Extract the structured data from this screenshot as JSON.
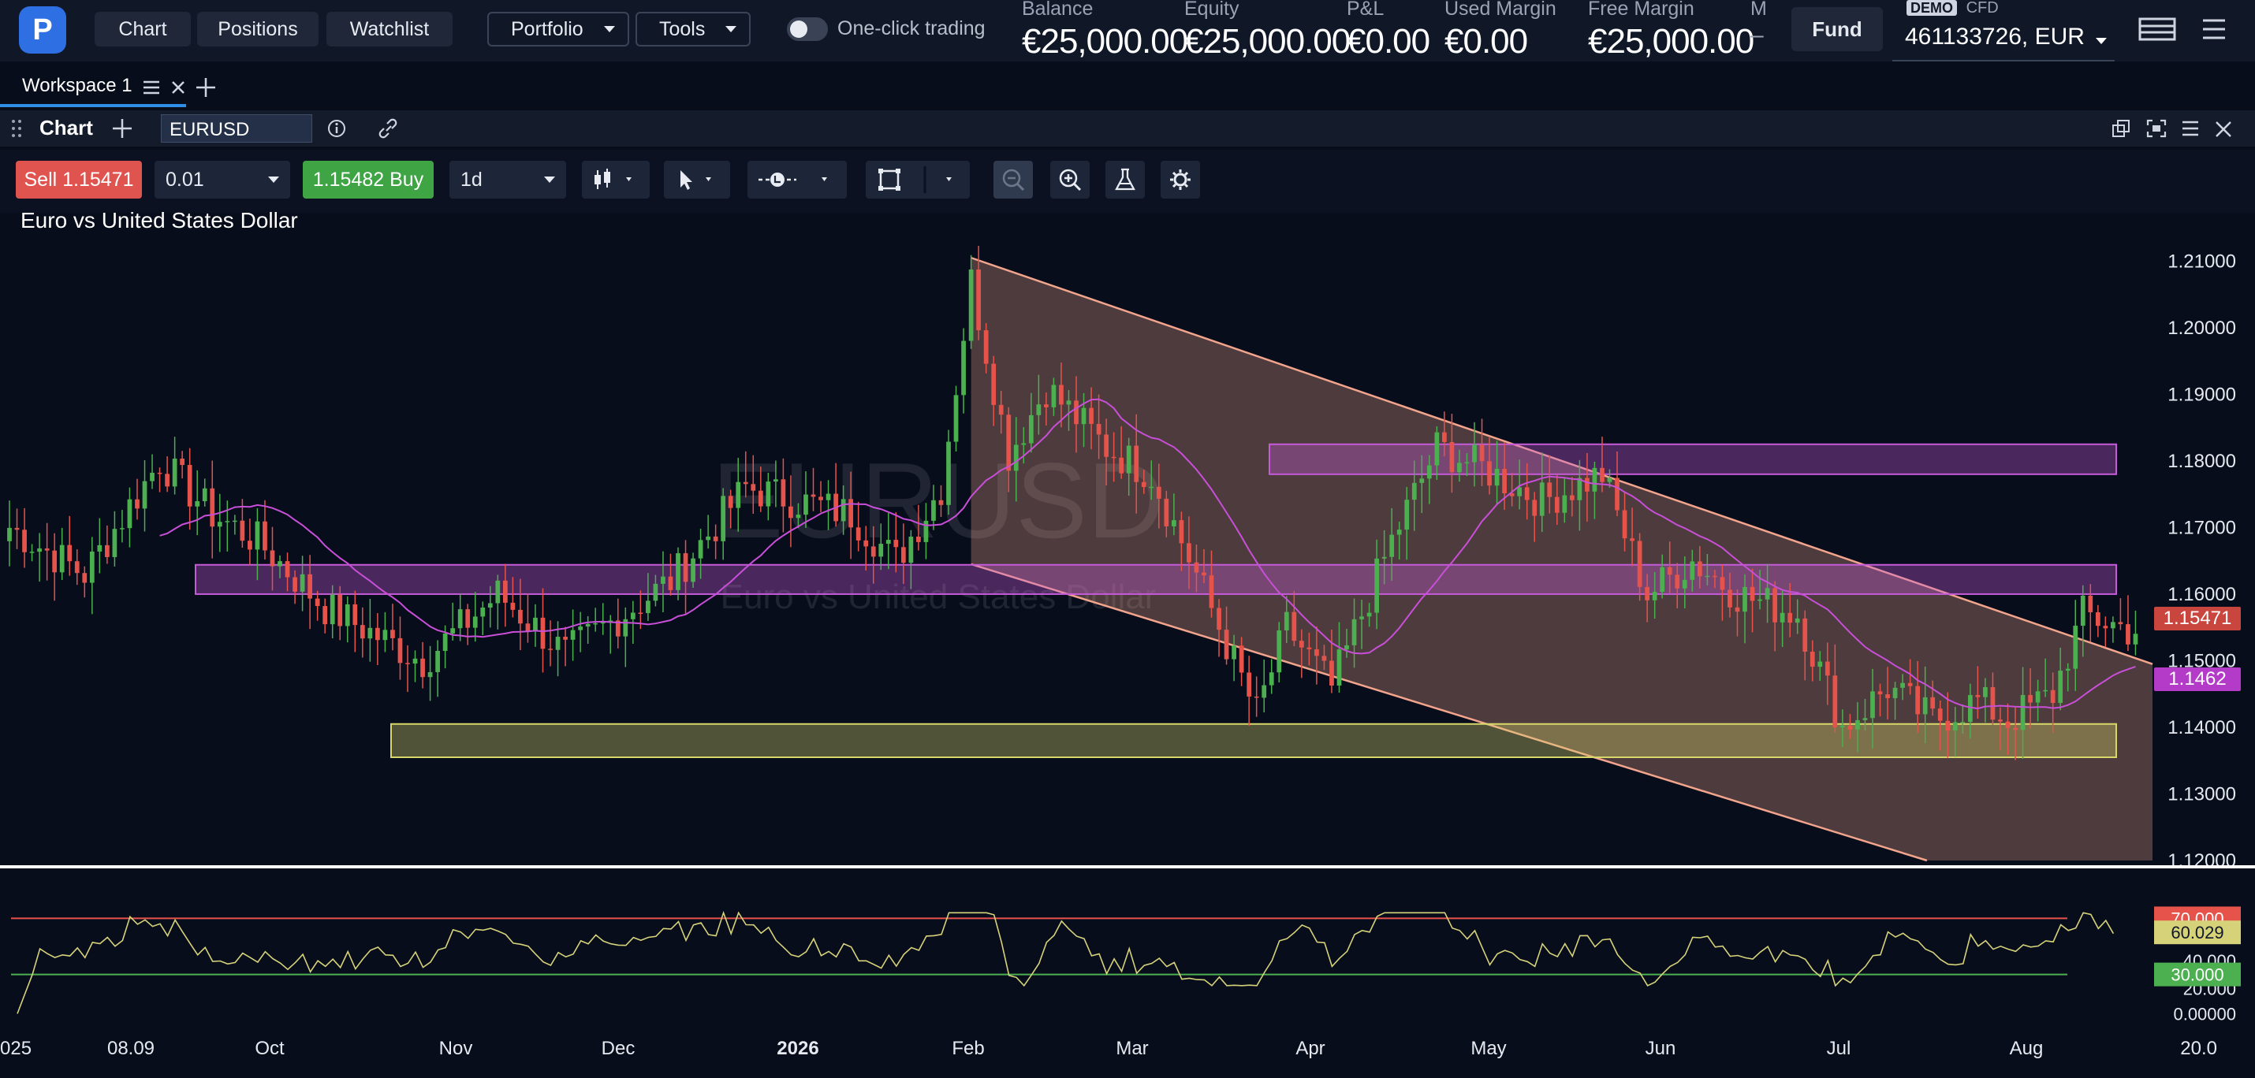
{
  "header": {
    "logo_letter": "P",
    "nav": [
      "Chart",
      "Positions",
      "Watchlist"
    ],
    "portfolio_label": "Portfolio",
    "tools_label": "Tools",
    "one_click_label": "One-click trading",
    "stats": [
      {
        "label": "Balance",
        "value": "€25,000.00"
      },
      {
        "label": "Equity",
        "value": "€25,000.00"
      },
      {
        "label": "P&L",
        "value": "€0.00"
      },
      {
        "label": "Used Margin",
        "value": "€0.00"
      },
      {
        "label": "Free Margin",
        "value": "€25,000.00"
      },
      {
        "label": "M",
        "value": "–"
      }
    ],
    "fund_label": "Fund",
    "demo_badge": "DEMO",
    "cfd_label": "CFD",
    "account": "461133726, EUR"
  },
  "workspace": {
    "tab_label": "Workspace 1"
  },
  "chart_panel": {
    "title": "Chart",
    "symbol": "EURUSD",
    "sell_label": "Sell",
    "sell_price": "1.15471",
    "quantity": "0.01",
    "buy_price": "1.15482",
    "buy_label": "Buy",
    "timeframe": "1d",
    "instrument_name": "Euro vs United States Dollar",
    "watermark_symbol": "EURUSD",
    "watermark_name": "Euro vs United States Dollar"
  },
  "colors": {
    "bull": "#4caf50",
    "bear": "#e5534b",
    "ma": "#c84fd8",
    "channel": "#f2a48c",
    "zone_magenta": "#c55bd8",
    "zone_yellow": "#d8d86a",
    "rsi_line": "#d6d27a",
    "rsi_upper": "#e5534b",
    "rsi_lower": "#4caf50"
  },
  "chart_data": {
    "type": "candlestick",
    "price_axis": [
      "1.21000",
      "1.20000",
      "1.19000",
      "1.18000",
      "1.17000",
      "1.16000",
      "1.15000",
      "1.14000",
      "1.13000",
      "1.12000"
    ],
    "ylim": [
      1.12,
      1.213
    ],
    "x_labels": [
      "025",
      "08.09",
      "Oct",
      "Nov",
      "Dec",
      "2026",
      "Feb",
      "Mar",
      "Apr",
      "May",
      "Jun",
      "Jul",
      "Aug",
      "20.0"
    ],
    "price_tags": {
      "last": "1.15471",
      "ma": "1.1462"
    },
    "series": [
      {
        "name": "EURUSD",
        "anchors": [
          [
            0,
            1.17
          ],
          [
            10,
            1.163
          ],
          [
            20,
            1.18
          ],
          [
            27,
            1.172
          ],
          [
            33,
            1.168
          ],
          [
            42,
            1.158
          ],
          [
            55,
            1.15
          ],
          [
            65,
            1.16
          ],
          [
            74,
            1.151
          ],
          [
            88,
            1.162
          ],
          [
            98,
            1.176
          ],
          [
            112,
            1.172
          ],
          [
            118,
            1.165
          ],
          [
            124,
            1.176
          ],
          [
            128,
            1.207
          ],
          [
            133,
            1.181
          ],
          [
            138,
            1.191
          ],
          [
            146,
            1.182
          ],
          [
            152,
            1.178
          ],
          [
            158,
            1.163
          ],
          [
            166,
            1.142
          ],
          [
            170,
            1.155
          ],
          [
            176,
            1.146
          ],
          [
            184,
            1.168
          ],
          [
            190,
            1.182
          ],
          [
            196,
            1.179
          ],
          [
            204,
            1.174
          ],
          [
            212,
            1.178
          ],
          [
            218,
            1.16
          ],
          [
            224,
            1.165
          ],
          [
            230,
            1.16
          ],
          [
            238,
            1.157
          ],
          [
            244,
            1.14
          ],
          [
            250,
            1.146
          ],
          [
            256,
            1.141
          ],
          [
            262,
            1.144
          ],
          [
            266,
            1.141
          ],
          [
            272,
            1.145
          ],
          [
            276,
            1.157
          ],
          [
            282,
            1.1547
          ]
        ]
      }
    ],
    "zones": [
      {
        "from": 1.1825,
        "to": 1.178,
        "color": "magenta"
      },
      {
        "from": 1.1644,
        "to": 1.16,
        "color": "magenta"
      },
      {
        "from": 1.1405,
        "to": 1.1355,
        "color": "yellow"
      }
    ],
    "channel": {
      "upper": [
        [
          1.2105,
          1.1495
        ]
      ],
      "lower": [
        [
          1.1645,
          1.1095
        ]
      ]
    },
    "rsi": {
      "levels": [
        "70.000",
        "60.029",
        "40.000",
        "20.000",
        "0.00000",
        "30.000"
      ],
      "current": "60.029",
      "upper": 70,
      "lower": 30
    }
  }
}
